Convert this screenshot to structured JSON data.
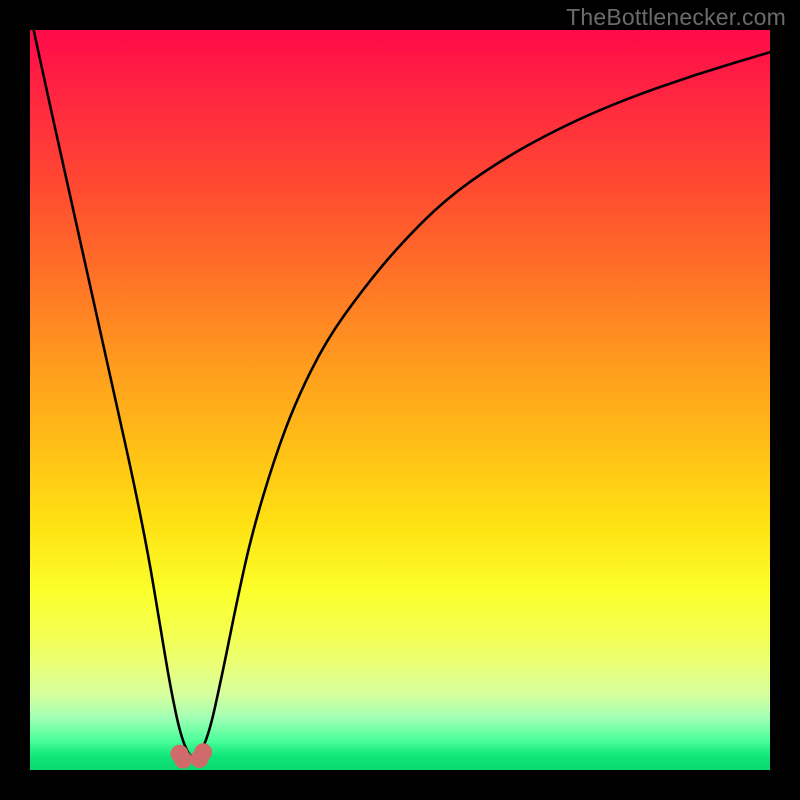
{
  "watermark": {
    "text": "TheBottlenecker.com"
  },
  "chart_data": {
    "type": "line",
    "title": "",
    "xlabel": "",
    "ylabel": "",
    "xlim": [
      0,
      100
    ],
    "ylim": [
      0,
      100
    ],
    "series": [
      {
        "name": "curve",
        "x": [
          0.5,
          2,
          4,
          6,
          8,
          10,
          12,
          14,
          16,
          17.5,
          19,
          20.5,
          22.1,
          24,
          26,
          28,
          30,
          33,
          36,
          40,
          45,
          50,
          56,
          63,
          71,
          80,
          90,
          100
        ],
        "values": [
          100,
          93,
          84,
          75,
          66,
          57,
          48,
          39,
          29,
          20,
          11,
          4,
          1,
          4,
          13,
          23,
          32,
          42,
          50,
          58,
          65,
          71,
          77,
          82,
          86.5,
          90.5,
          94,
          97
        ]
      }
    ],
    "marker_cluster": {
      "note": "small pink rounded dots near valley minimum",
      "points_x": [
        20.2,
        20.7,
        22.9,
        23.4
      ],
      "points_y": [
        2.2,
        1.4,
        1.5,
        2.4
      ]
    },
    "gradient_stops_pct": [
      0,
      9,
      20,
      32,
      44,
      55,
      67,
      76,
      82,
      86,
      90,
      93,
      96,
      98,
      100
    ],
    "gradient_colors": [
      "#ff0a4a",
      "#ff2640",
      "#ff4632",
      "#ff6e28",
      "#ff971f",
      "#ffbb17",
      "#ffe213",
      "#fbff2c",
      "#f3ff53",
      "#e9ff79",
      "#d4ffa0",
      "#9fffb4",
      "#4cff9a",
      "#11e87a",
      "#0bd86e"
    ]
  }
}
